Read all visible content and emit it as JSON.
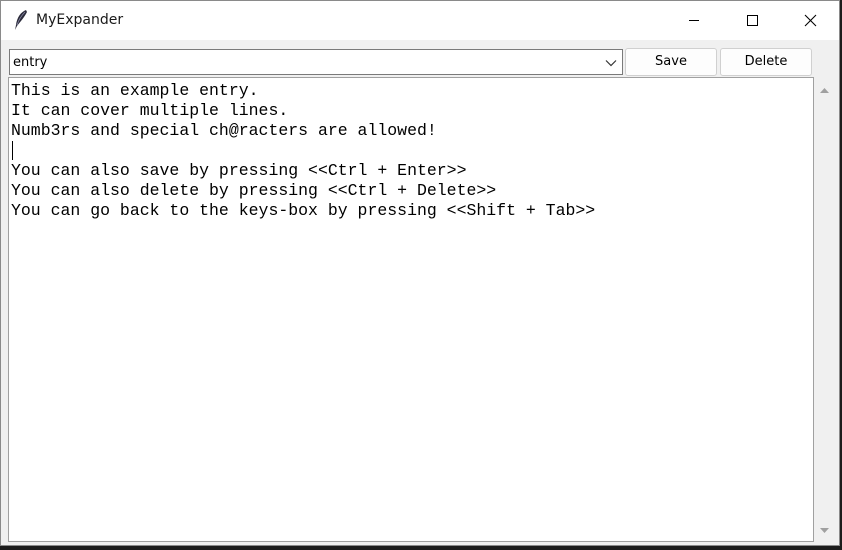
{
  "window": {
    "title": "MyExpander",
    "icon": "feather-icon"
  },
  "toolbar": {
    "entry_value": "entry",
    "save_label": "Save",
    "delete_label": "Delete"
  },
  "editor": {
    "lines": [
      "This is an example entry.",
      "It can cover multiple lines.",
      "Numb3rs and special ch@racters are allowed!",
      "",
      "You can also save by pressing <<Ctrl + Enter>>",
      "You can also delete by pressing <<Ctrl + Delete>>",
      "You can go back to the keys-box by pressing <<Shift + Tab>>"
    ]
  },
  "colors": {
    "window_bg": "#f0f0f0",
    "titlebar_bg": "#ffffff",
    "editor_bg": "#ffffff",
    "border": "#7a7a7a"
  }
}
